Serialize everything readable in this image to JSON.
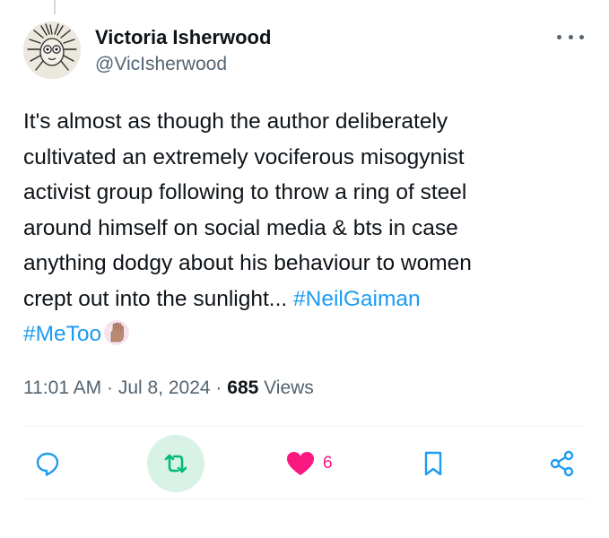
{
  "author": {
    "display_name": "Victoria Isherwood",
    "handle": "@VicIsherwood"
  },
  "tweet": {
    "lines": [
      "It's almost as though the author deliberately",
      "cultivated an extremely vociferous misogynist",
      "activist group following to throw a ring of steel",
      "around himself on social media & bts in case",
      "anything dodgy about his behaviour to women",
      "crept out into the sunlight... "
    ],
    "hashtag_1": "#NeilGaiman",
    "hashtag_2": "#MeToo",
    "emoji": "raised-hand-emoji"
  },
  "meta": {
    "time": "11:01 AM",
    "sep1": " · ",
    "date": "Jul 8, 2024",
    "sep2": " · ",
    "views_count": "685",
    "views_label": " Views"
  },
  "actions": {
    "reply_icon": "reply-icon",
    "retweet_icon": "retweet-icon",
    "like_icon": "heart-icon",
    "like_count": "6",
    "bookmark_icon": "bookmark-icon",
    "share_icon": "share-icon"
  },
  "colors": {
    "text": "#0f1419",
    "secondary": "#536471",
    "link": "#1d9bf0",
    "like": "#f91880",
    "retweet_highlight_bg": "#d8f3e6",
    "retweet_icon": "#00ba7c",
    "action_icon": "#1d9bf0"
  }
}
